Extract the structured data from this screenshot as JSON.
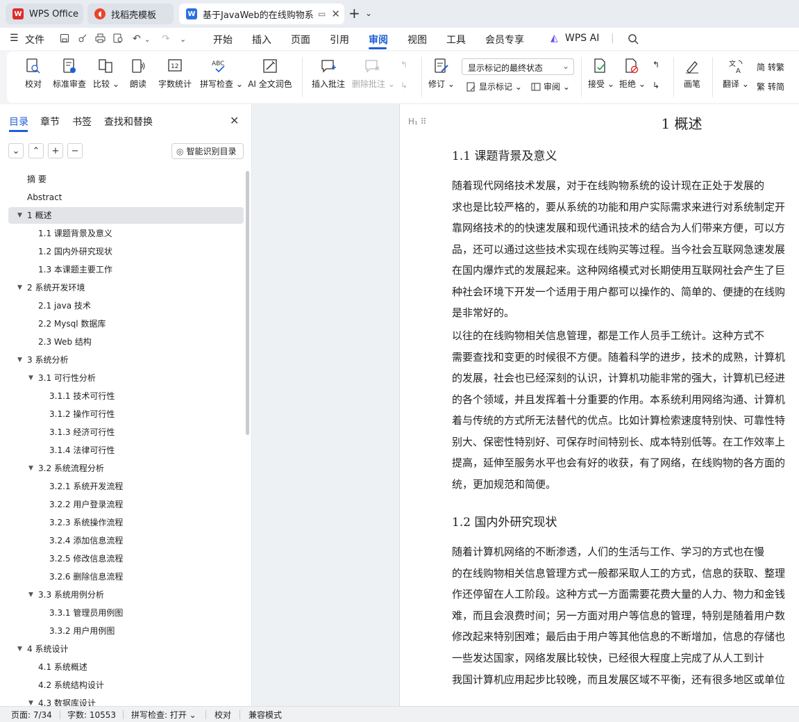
{
  "tabs": [
    {
      "label": "WPS Office"
    },
    {
      "label": "找稻壳模板"
    },
    {
      "label": "基于JavaWeb的在线购物系统"
    }
  ],
  "menu": {
    "file": "文件",
    "items": [
      "开始",
      "插入",
      "页面",
      "引用",
      "审阅",
      "视图",
      "工具",
      "会员专享"
    ],
    "active": "审阅",
    "wps_ai": "WPS AI"
  },
  "ribbon": {
    "proofread": "校对",
    "standard_review": "标准审查",
    "compare": "比较",
    "read_aloud": "朗读",
    "word_count": "字数统计",
    "spell_check": "拼写检查",
    "ai_polish": "AI 全文润色",
    "insert_comment": "插入批注",
    "delete_comment": "删除批注",
    "revise": "修订",
    "markup_dropdown": "显示标记的最终状态",
    "show_markup": "显示标记",
    "review": "审阅",
    "accept": "接受",
    "reject": "拒绝",
    "pen": "画笔",
    "translate": "翻译",
    "to_traditional": "转繁",
    "to_simplified": "转简"
  },
  "nav": {
    "tabs": [
      "目录",
      "章节",
      "书签",
      "查找和替换"
    ],
    "smart_toc": "智能识别目录",
    "toc": [
      {
        "label": "摘    要",
        "level": 1,
        "arrow": false
      },
      {
        "label": "Abstract",
        "level": 1,
        "arrow": false
      },
      {
        "label": "1  概述",
        "level": 1,
        "arrow": true,
        "selected": true
      },
      {
        "label": "1.1 课题背景及意义",
        "level": 2,
        "arrow": false
      },
      {
        "label": "1.2  国内外研究现状",
        "level": 2,
        "arrow": false
      },
      {
        "label": "1.3  本课题主要工作",
        "level": 2,
        "arrow": false
      },
      {
        "label": "2  系统开发环境",
        "level": 1,
        "arrow": true
      },
      {
        "label": "2.1 java 技术",
        "level": 2,
        "arrow": false
      },
      {
        "label": "2.2 Mysql 数据库",
        "level": 2,
        "arrow": false
      },
      {
        "label": "2.3 Web 结构",
        "level": 2,
        "arrow": false
      },
      {
        "label": "3  系统分析",
        "level": 1,
        "arrow": true
      },
      {
        "label": "3.1  可行性分析",
        "level": 2,
        "arrow": true
      },
      {
        "label": "3.1.1  技术可行性",
        "level": 3,
        "arrow": false
      },
      {
        "label": "3.1.2 操作可行性",
        "level": 3,
        "arrow": false
      },
      {
        "label": "3.1.3  经济可行性",
        "level": 3,
        "arrow": false
      },
      {
        "label": "3.1.4  法律可行性",
        "level": 3,
        "arrow": false
      },
      {
        "label": "3.2 系统流程分析",
        "level": 2,
        "arrow": true
      },
      {
        "label": "3.2.1 系统开发流程",
        "level": 3,
        "arrow": false
      },
      {
        "label": "3.2.2  用户登录流程",
        "level": 3,
        "arrow": false
      },
      {
        "label": "3.2.3  系统操作流程",
        "level": 3,
        "arrow": false
      },
      {
        "label": "3.2.4  添加信息流程",
        "level": 3,
        "arrow": false
      },
      {
        "label": "3.2.5  修改信息流程",
        "level": 3,
        "arrow": false
      },
      {
        "label": "3.2.6  删除信息流程",
        "level": 3,
        "arrow": false
      },
      {
        "label": "3.3 系统用例分析",
        "level": 2,
        "arrow": true
      },
      {
        "label": "3.3.1 管理员用例图",
        "level": 3,
        "arrow": false
      },
      {
        "label": "3.3.2 用户用例图",
        "level": 3,
        "arrow": false
      },
      {
        "label": "4  系统设计",
        "level": 1,
        "arrow": true
      },
      {
        "label": "4.1  系统概述",
        "level": 2,
        "arrow": false
      },
      {
        "label": "4.2  系统结构设计",
        "level": 2,
        "arrow": false
      },
      {
        "label": "4.3 数据库设计",
        "level": 2,
        "arrow": true
      }
    ]
  },
  "document": {
    "chapter_title": "1  概述",
    "section1_title": "1.1 课题背景及意义",
    "para1": [
      "    随着现代网络技术发展，对于在线购物系统的设计现在正处于发展的",
      "求也是比较严格的，要从系统的功能和用户实际需求来进行对系统制定开",
      "靠网络技术的的快速发展和现代通讯技术的结合为人们带来方便，可以方",
      "品，还可以通过这些技术实现在线购买等过程。当今社会互联网急速发展",
      "在国内爆炸式的发展起来。这种网络模式对长期使用互联网社会产生了巨",
      "种社会环境下开发一个适用于用户都可以操作的、简单的、便捷的在线购",
      "是非常好的。"
    ],
    "para2": [
      "    以往的在线购物相关信息管理，都是工作人员手工统计。这种方式不",
      "需要查找和变更的时候很不方便。随着科学的进步，技术的成熟，计算机",
      "的发展，社会也已经深刻的认识，计算机功能非常的强大，计算机已经进",
      "的各个领域，并且发挥着十分重要的作用。本系统利用网络沟通、计算机",
      "着与传统的方式所无法替代的优点。比如计算检索速度特别快、可靠性特",
      "别大、保密性特别好、可保存时间特别长、成本特别低等。在工作效率上",
      "提高，延伸至服务水平也会有好的收获，有了网络，在线购物的各方面的",
      "统，更加规范和简便。"
    ],
    "section2_title": "1.2  国内外研究现状",
    "para3": [
      "    随着计算机网络的不断渗透，人们的生活与工作、学习的方式也在慢",
      "的在线购物相关信息管理方式一般都采取人工的方式，信息的获取、整理",
      "作还停留在人工阶段。这种方式一方面需要花费大量的人力、物力和金钱",
      "难，而且会浪费时间；另一方面对用户等信息的管理，特别是随着用户数",
      "修改起来特别困难；最后由于用户等其他信息的不断增加，信息的存储也"
    ],
    "para4": [
      "    一些发达国家，网络发展比较快，已经很大程度上完成了从人工到计",
      "我国计算机应用起步比较晚，而且发展区域不平衡，还有很多地区或单位"
    ]
  },
  "status": {
    "page": "页面: 7/34",
    "words": "字数: 10553",
    "spell": "拼写检查: 打开",
    "proof": "校对",
    "compat": "兼容模式"
  },
  "colors": {
    "accent": "#1e5fd6",
    "wps_red": "#e02b2b"
  }
}
